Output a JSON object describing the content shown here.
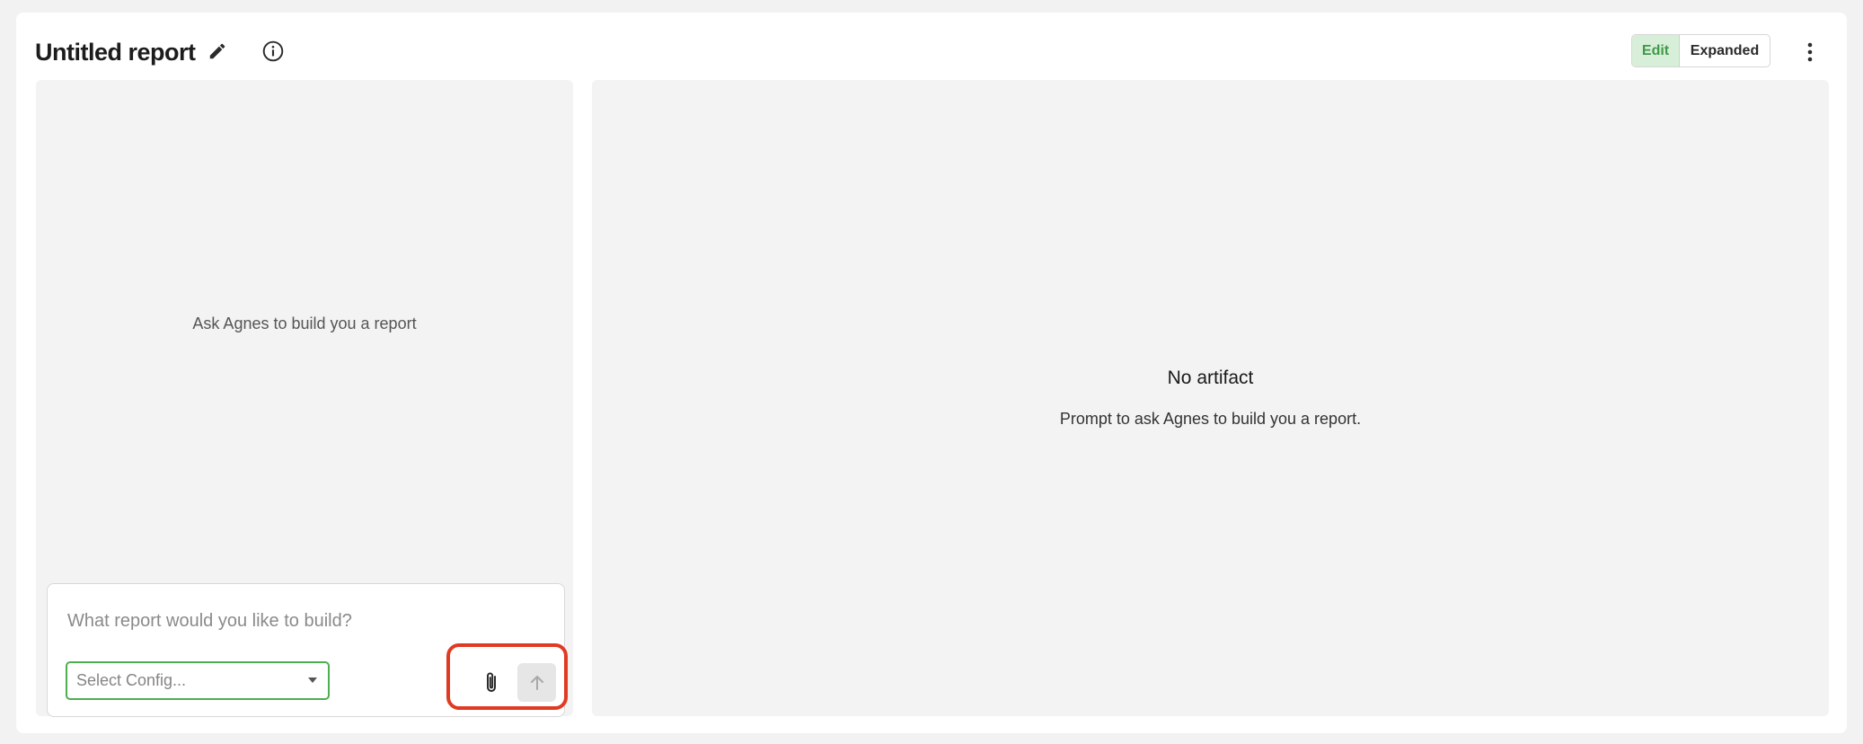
{
  "header": {
    "title": "Untitled report",
    "view_toggle": {
      "options": [
        "Edit",
        "Expanded"
      ],
      "selected": "Edit"
    },
    "icons": [
      "pencil-icon",
      "info-icon",
      "more-vertical-icon"
    ]
  },
  "chat_panel": {
    "empty_message": "Ask Agnes to build you a report",
    "composer": {
      "placeholder": "What report would you like to build?",
      "config_select_placeholder": "Select Config...",
      "attach_icon": "paperclip-icon",
      "send_icon": "arrow-up-icon"
    }
  },
  "artifact_panel": {
    "title": "No artifact",
    "subtitle": "Prompt to ask Agnes to build you a report."
  },
  "colors": {
    "accent_green": "#4caf50",
    "highlight_red": "#e03a22"
  }
}
